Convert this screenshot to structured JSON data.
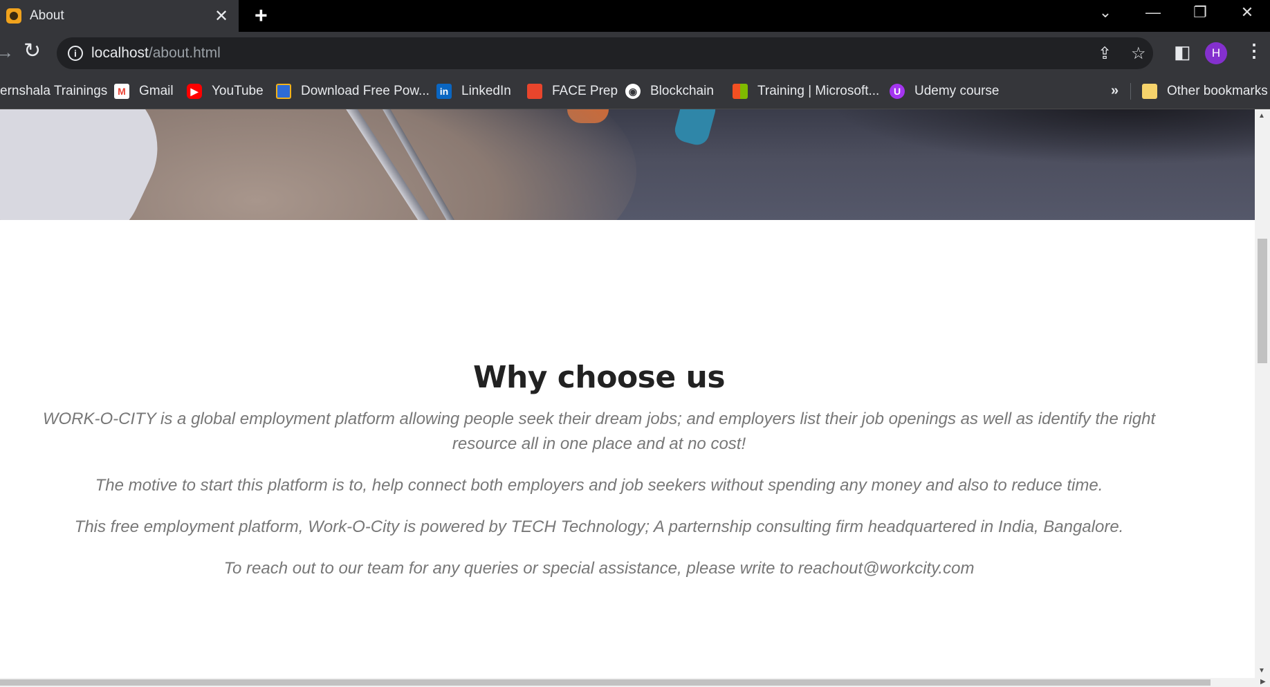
{
  "browser": {
    "tab_title": "About",
    "url_host": "localhost",
    "url_path": "/about.html",
    "avatar_letter": "H"
  },
  "bookmarks": [
    {
      "label": "ernshala Trainings",
      "icon": "none"
    },
    {
      "label": "Gmail",
      "icon": "gmail-icon"
    },
    {
      "label": "YouTube",
      "icon": "youtube-icon"
    },
    {
      "label": "Download Free Pow...",
      "icon": "download-site-icon"
    },
    {
      "label": "LinkedIn",
      "icon": "linkedin-icon"
    },
    {
      "label": "FACE Prep",
      "icon": "faceprep-icon"
    },
    {
      "label": "Blockchain",
      "icon": "globe-icon"
    },
    {
      "label": "Training | Microsoft...",
      "icon": "microsoft-icon"
    },
    {
      "label": "Udemy course",
      "icon": "udemy-icon"
    }
  ],
  "bookmarks_overflow": "»",
  "other_bookmarks": "Other bookmarks",
  "page": {
    "heading": "Why choose us",
    "paragraphs": [
      "WORK-O-CITY is a global employment platform allowing people seek their dream jobs; and employers list their job openings as well as identify the right resource all in one place and at no cost!",
      "The motive to start this platform is to, help connect both employers and job seekers without spending any money and also to reduce time.",
      "This free employment platform, Work-O-City is powered by TECH Technology; A parternship consulting firm headquartered in India, Bangalore.",
      "To reach out to our team for any queries or special assistance, please write to reachout@workcity.com"
    ]
  },
  "colors": {
    "chrome_dark": "#35363a",
    "heading": "#222222",
    "body_text": "#777777",
    "avatar": "#8430ce"
  }
}
